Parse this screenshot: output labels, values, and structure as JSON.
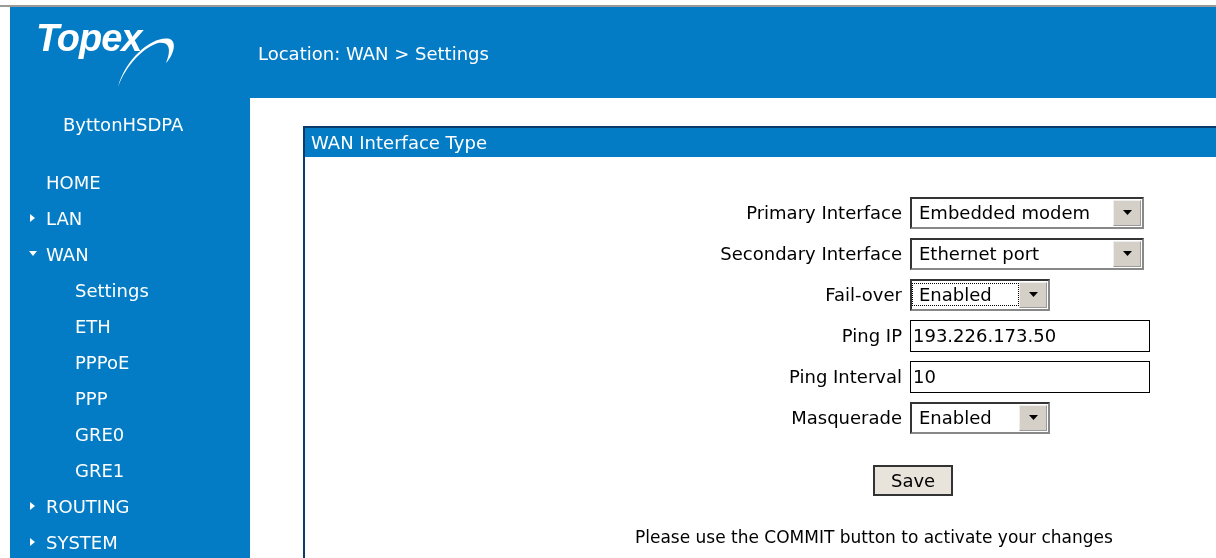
{
  "header": {
    "logo": "Topex",
    "location": "Location: WAN > Settings"
  },
  "sidebar": {
    "device": "ByttonHSDPA",
    "items": [
      {
        "label": "HOME"
      },
      {
        "label": "LAN",
        "expanded": false
      },
      {
        "label": "WAN",
        "expanded": true,
        "children": [
          {
            "label": "Settings"
          },
          {
            "label": "ETH"
          },
          {
            "label": "PPPoE"
          },
          {
            "label": "PPP"
          },
          {
            "label": "GRE0"
          },
          {
            "label": "GRE1"
          }
        ]
      },
      {
        "label": "ROUTING",
        "expanded": false
      },
      {
        "label": "SYSTEM",
        "expanded": false
      }
    ]
  },
  "panel": {
    "title": "WAN Interface Type",
    "fields": [
      {
        "kind": "select",
        "label": "Primary Interface",
        "value": "Embedded modem",
        "wide": true,
        "focused": false
      },
      {
        "kind": "select",
        "label": "Secondary Interface",
        "value": "Ethernet port",
        "wide": true,
        "focused": false
      },
      {
        "kind": "select",
        "label": "Fail-over",
        "value": "Enabled",
        "wide": false,
        "focused": true
      },
      {
        "kind": "text",
        "label": "Ping IP",
        "value": "193.226.173.50"
      },
      {
        "kind": "text",
        "label": "Ping Interval",
        "value": "10"
      },
      {
        "kind": "select",
        "label": "Masquerade",
        "value": "Enabled",
        "wide": false,
        "focused": false
      }
    ],
    "save": "Save",
    "note": "Please use the COMMIT button to activate your changes"
  }
}
